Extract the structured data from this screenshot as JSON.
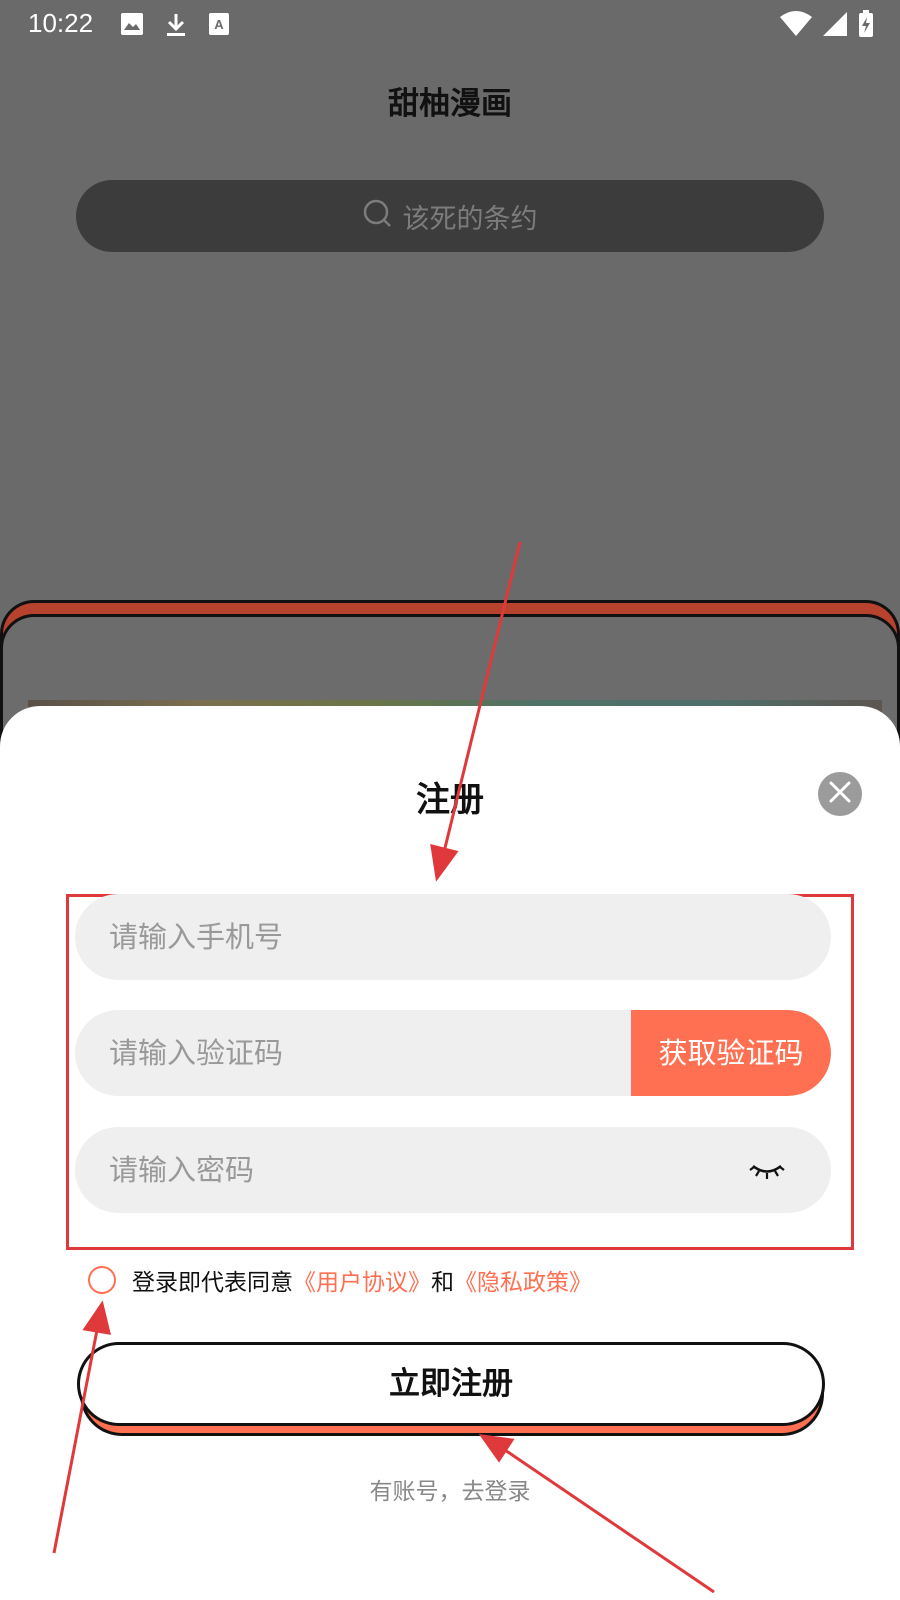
{
  "status_bar": {
    "time": "10:22",
    "icons": [
      "image-icon",
      "download-icon",
      "text-a-icon",
      "wifi-icon",
      "signal-icon",
      "battery-charging-icon"
    ]
  },
  "app": {
    "title": "甜柚漫画",
    "search": {
      "placeholder": "该死的条约",
      "icon": "search-icon"
    }
  },
  "register_sheet": {
    "title": "注册",
    "close_icon": "close-icon",
    "fields": {
      "phone_placeholder": "请输入手机号",
      "code_placeholder": "请输入验证码",
      "get_code_label": "获取验证码",
      "password_placeholder": "请输入密码",
      "password_toggle_icon": "eye-closed-icon"
    },
    "agreement": {
      "prefix": "登录即代表同意",
      "user_agreement": "《用户协议》",
      "and": "和",
      "privacy_policy": "《隐私政策》",
      "checked": false
    },
    "register_label": "立即注册",
    "login_link": "有账号，去登录"
  },
  "colors": {
    "accent": "#ff6f51",
    "annotation_red": "#e0393b",
    "overlay": "#6a6a6a",
    "input_bg": "#efefef"
  }
}
